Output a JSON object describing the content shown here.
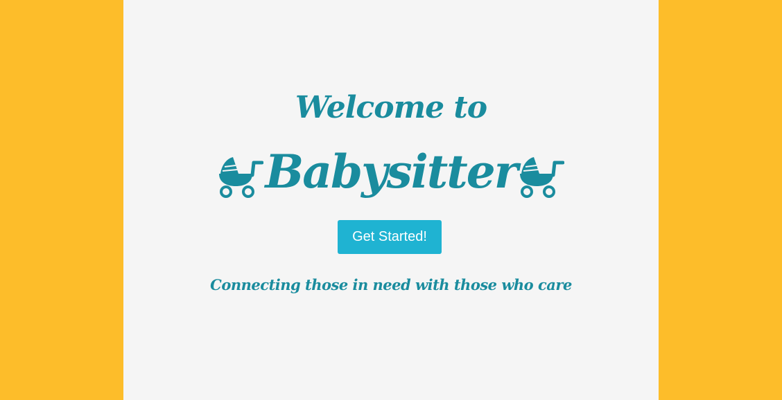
{
  "colors": {
    "side_background": "#fdbd2a",
    "page_background": "#f5f5f5",
    "brand_teal": "#1a8c9e",
    "button": "#1fb3d2",
    "button_text": "#ffffff"
  },
  "hero": {
    "welcome": "Welcome to",
    "title": "Babysitter",
    "left_icon": "baby-carriage-icon",
    "right_icon": "baby-carriage-icon",
    "cta_label": "Get Started!",
    "tagline": "Connecting those in need with those who care"
  }
}
